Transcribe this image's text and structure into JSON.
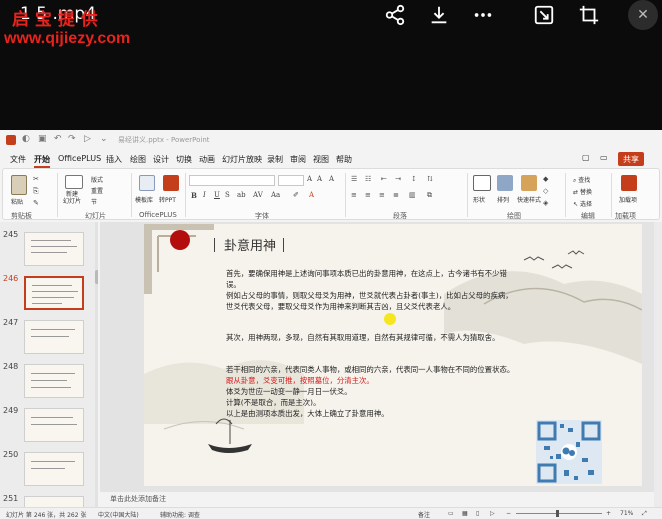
{
  "player": {
    "title": "1 5 .mp4",
    "watermark_url": "www.qijiezy.com",
    "icons": [
      "share-icon",
      "download-icon",
      "more-icon",
      "pip-icon",
      "crop-icon",
      "close-icon"
    ]
  },
  "ppt": {
    "doc_title": "易经讲义.pptx - PowerPoint",
    "menu": [
      "文件",
      "开始",
      "OfficePLUS",
      "插入",
      "绘图",
      "设计",
      "切换",
      "动画",
      "幻灯片放映",
      "录制",
      "审阅",
      "视图",
      "帮助"
    ],
    "active_menu": "开始",
    "share_label": "共享",
    "ribbon": {
      "groups": [
        "剪贴板",
        "幻灯片",
        "OfficePLUS",
        "字体",
        "段落",
        "绘图",
        "编辑",
        "加载项"
      ],
      "buttons": {
        "paste": "粘贴",
        "new_slide": "新建\n幻灯片",
        "layout": "版式",
        "reset": "重置",
        "section": "节",
        "template": "模板库",
        "convert": "转PPT",
        "shapes": "形状",
        "arrange": "排列",
        "quick_styles": "快速样式",
        "find": "查找",
        "replace": "替换",
        "select": "选择",
        "addins": "加载项"
      }
    },
    "slides": {
      "numbers": [
        "245",
        "246",
        "247",
        "248",
        "249",
        "250",
        "251"
      ],
      "selected": "246"
    },
    "slide": {
      "title": "卦意用神",
      "para1": "首先，要确保用神是上述询问事项本质已出的卦意用神，在这点上，古今诸书有不少错误。",
      "para2": "例如占父母的事情，则取父母爻为用神，世爻就代表占卦者(事主)，比如占父母的疾病，世爻代表父母，要取父母爻作为用神来判断其吉凶，且父爻代表老人。",
      "para3": "其次，用神两现，多现，自然有其取用道理，自然有其规律可循，不需人为猜取舍。",
      "para4_start": "若干相同的六亲，代表同类人事物，或相同的六亲，代表同一人事物在不同的位置状态。",
      "para4_red": "跟从卦意，爻变可推，按照墓位，分清主次。",
      "para5": "体爻为世应一动变一静一月日一伏爻。",
      "para6": "计算(不是取合，而是主次)。",
      "para7": "以上是由测项本质出发，大体上确立了卦意用神。"
    },
    "notes_placeholder": "单击此处添加备注",
    "status": {
      "slide_pos": "幻灯片 第 246 张，共 262 张",
      "language": "中文(中国大陆)",
      "accessibility": "辅助功能: 调查",
      "notes": "备注",
      "zoom": "71%"
    }
  },
  "colors": {
    "ppt_accent": "#c43e1c",
    "watermark": "#e8231d",
    "title_dot": "#b40d0d",
    "highlight_text": "#d61a1a"
  }
}
